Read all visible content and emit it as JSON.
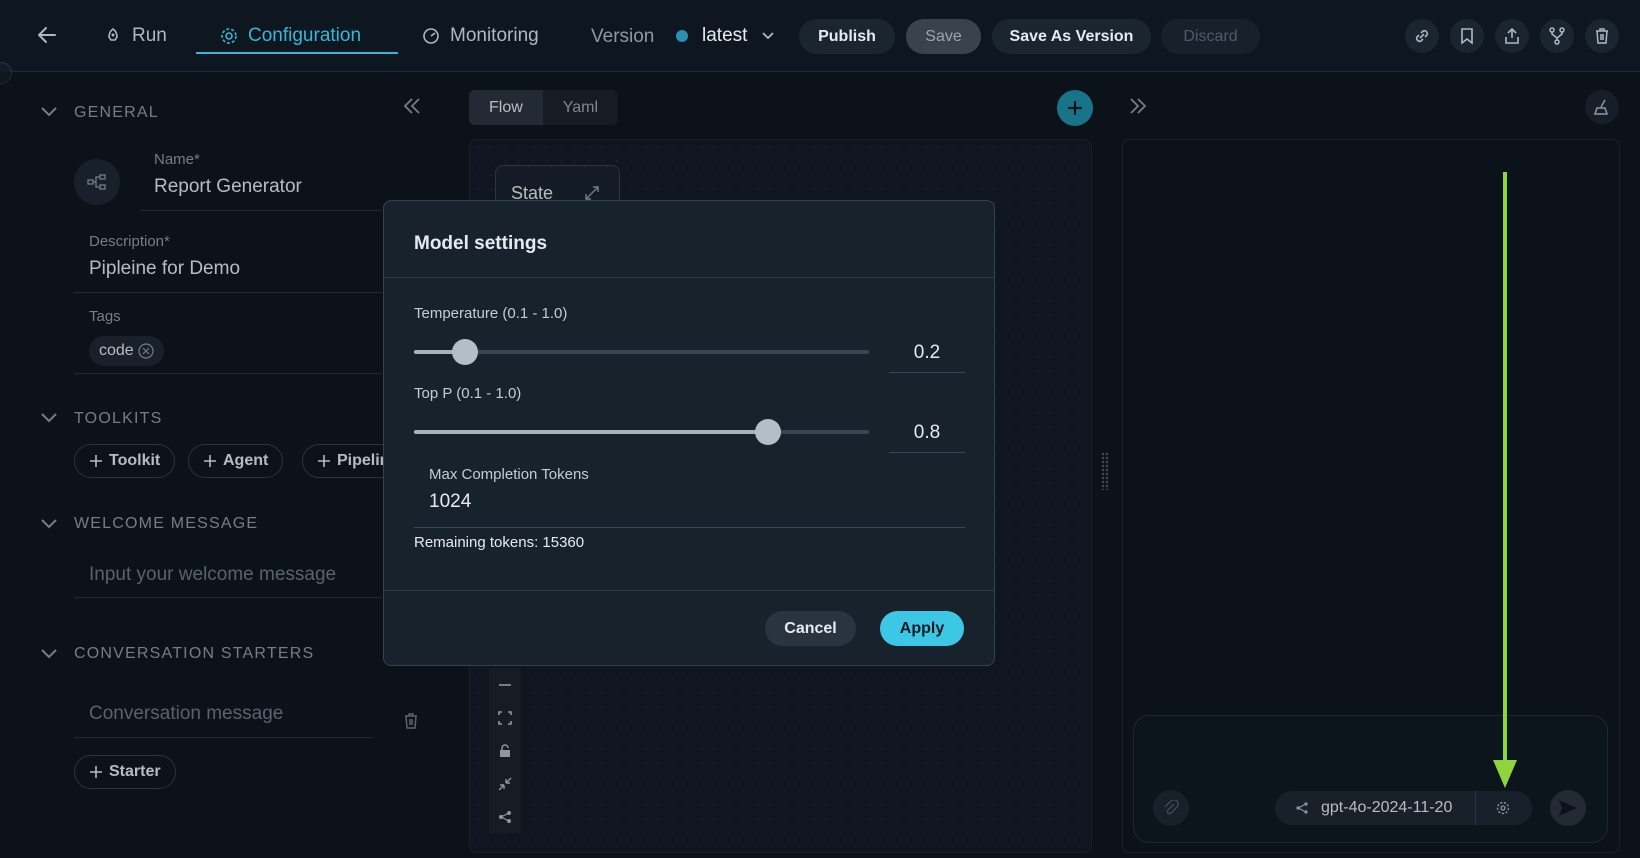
{
  "topbar": {
    "tabs": [
      {
        "label": "Run",
        "icon": "rocket-icon"
      },
      {
        "label": "Configuration",
        "icon": "gear-icon"
      },
      {
        "label": "Monitoring",
        "icon": "gauge-icon"
      }
    ],
    "version_label": "Version",
    "version_value": "latest",
    "version_dot_color": "#2a8fb3",
    "publish_label": "Publish",
    "save_label": "Save",
    "save_as_version_label": "Save As Version",
    "discard_label": "Discard"
  },
  "left": {
    "general_title": "GENERAL",
    "name_label": "Name*",
    "name_value": "Report Generator",
    "description_label": "Description*",
    "description_value": "Pipleine for Demo",
    "tags_label": "Tags",
    "tags": [
      "code"
    ],
    "toolkits_title": "TOOLKITS",
    "toolkit_buttons": [
      "Toolkit",
      "Agent",
      "Pipelin"
    ],
    "welcome_title": "WELCOME MESSAGE",
    "welcome_placeholder": "Input your welcome message",
    "starters_title": "CONVERSATION STARTERS",
    "starter_placeholder": "Conversation message",
    "starter_button": "Starter"
  },
  "center": {
    "view_tabs": [
      "Flow",
      "Yaml"
    ],
    "state_node_label": "State"
  },
  "right": {
    "model_name": "gpt-4o-2024-11-20"
  },
  "modal": {
    "title": "Model settings",
    "temperature_label": "Temperature (0.1 - 1.0)",
    "temperature_value": "0.2",
    "temperature_fraction": 0.111,
    "top_p_label": "Top P (0.1 - 1.0)",
    "top_p_value": "0.8",
    "top_p_fraction": 0.778,
    "max_tokens_label": "Max Completion Tokens",
    "max_tokens_value": "1024",
    "remaining_tokens": "Remaining tokens: 15360",
    "cancel_label": "Cancel",
    "apply_label": "Apply"
  },
  "colors": {
    "accent": "#35b8d6",
    "apply_button": "#3cc8e4",
    "annotation_arrow": "#8ed43a"
  }
}
